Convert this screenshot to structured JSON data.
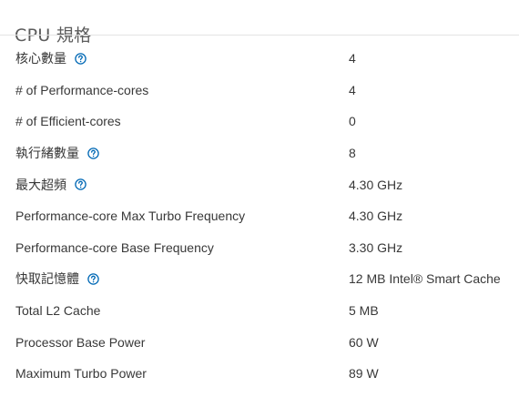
{
  "section": {
    "title": "CPU 規格"
  },
  "colors": {
    "help_icon": "#0068b5",
    "divider": "#e3e3e3"
  },
  "specs": [
    {
      "label": "核心數量",
      "value": "4",
      "help": true
    },
    {
      "label": "# of Performance-cores",
      "value": "4",
      "help": false
    },
    {
      "label": "# of Efficient-cores",
      "value": "0",
      "help": false
    },
    {
      "label": "執行緒數量",
      "value": "8",
      "help": true
    },
    {
      "label": "最大超頻",
      "value": "4.30 GHz",
      "help": true
    },
    {
      "label": "Performance-core Max Turbo Frequency",
      "value": "4.30 GHz",
      "help": false
    },
    {
      "label": "Performance-core Base Frequency",
      "value": "3.30 GHz",
      "help": false
    },
    {
      "label": "快取記憶體",
      "value": "12 MB Intel® Smart Cache",
      "help": true
    },
    {
      "label": "Total L2 Cache",
      "value": "5 MB",
      "help": false
    },
    {
      "label": "Processor Base Power",
      "value": "60 W",
      "help": false
    },
    {
      "label": "Maximum Turbo Power",
      "value": "89 W",
      "help": false
    }
  ]
}
